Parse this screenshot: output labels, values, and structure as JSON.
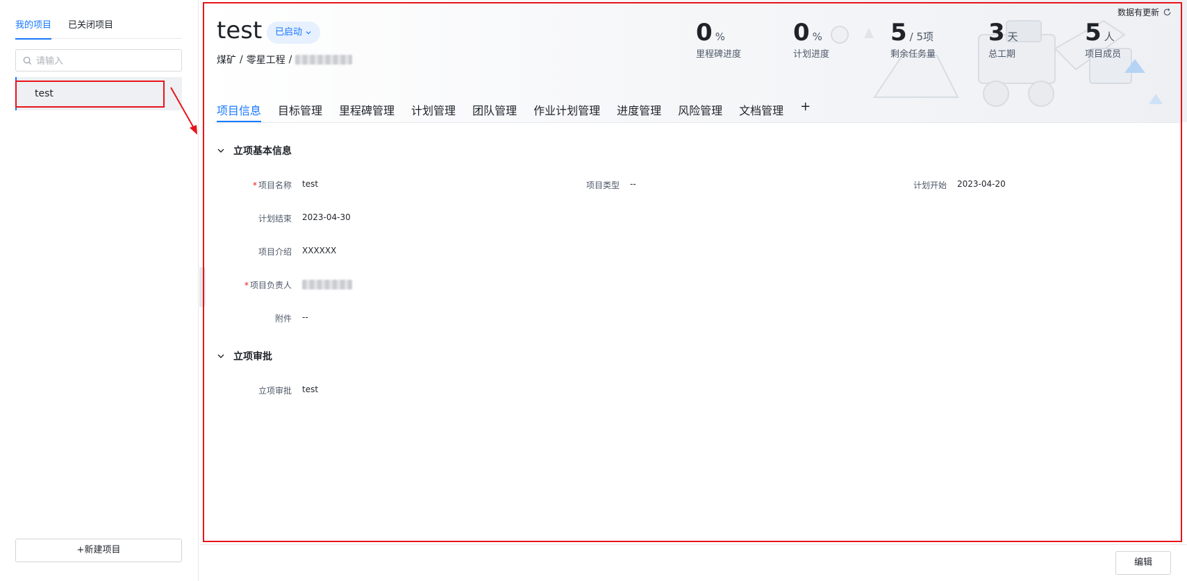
{
  "sidebar": {
    "tabs": [
      {
        "label": "我的项目"
      },
      {
        "label": "已关闭项目"
      }
    ],
    "search_placeholder": "请输入",
    "projects": [
      {
        "label": "test"
      }
    ],
    "new_button": "+新建项目"
  },
  "header": {
    "title": "test",
    "status": "已启动",
    "breadcrumb": [
      "煤矿",
      "零星工程"
    ],
    "refresh_label": "数据有更新",
    "stats": [
      {
        "value": "0",
        "unit": "%",
        "label": "里程碑进度"
      },
      {
        "value": "0",
        "unit": "%",
        "label": "计划进度"
      },
      {
        "value": "5",
        "unit": "/ 5项",
        "label": "剩余任务量"
      },
      {
        "value": "3",
        "unit": "天",
        "label": "总工期"
      },
      {
        "value": "5",
        "unit": "人",
        "label": "项目成员"
      }
    ]
  },
  "nav": {
    "items": [
      "项目信息",
      "目标管理",
      "里程碑管理",
      "计划管理",
      "团队管理",
      "作业计划管理",
      "进度管理",
      "风险管理",
      "文档管理"
    ],
    "add": "+"
  },
  "sections": {
    "basic": {
      "title": "立项基本信息",
      "fields": {
        "name": {
          "label": "项目名称",
          "value": "test"
        },
        "type": {
          "label": "项目类型",
          "value": "--"
        },
        "plan_start": {
          "label": "计划开始",
          "value": "2023-04-20"
        },
        "plan_end": {
          "label": "计划结束",
          "value": "2023-04-30"
        },
        "intro": {
          "label": "项目介绍",
          "value": "XXXXXX"
        },
        "owner": {
          "label": "项目负责人"
        },
        "attachment": {
          "label": "附件",
          "value": "--"
        }
      }
    },
    "approval": {
      "title": "立项审批",
      "fields": {
        "approval": {
          "label": "立项审批",
          "value": "test"
        }
      }
    }
  },
  "footer": {
    "edit_button": "编辑"
  },
  "colors": {
    "accent": "#1677ff",
    "highlight": "#e8131a"
  }
}
